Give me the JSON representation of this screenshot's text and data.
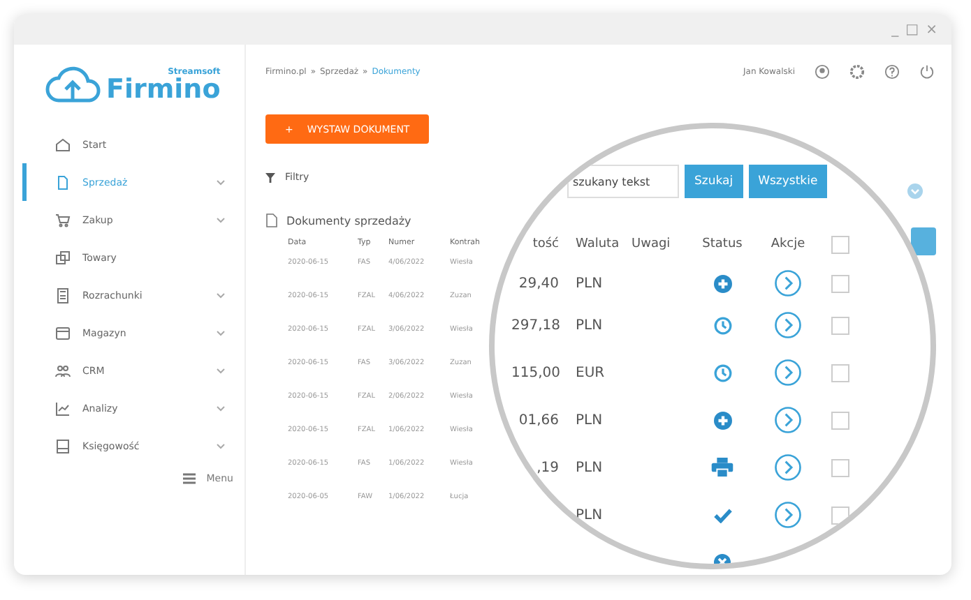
{
  "window": {
    "controls": [
      "_",
      "□",
      "×"
    ]
  },
  "logo": {
    "brand": "Streamsoft",
    "product": "Firmino"
  },
  "sidebar": {
    "items": [
      {
        "label": "Start",
        "kind": "home",
        "expandable": false,
        "selected": false
      },
      {
        "label": "Sprzedaż",
        "kind": "sales",
        "expandable": true,
        "selected": true
      },
      {
        "label": "Zakup",
        "kind": "purchase",
        "expandable": true,
        "selected": false
      },
      {
        "label": "Towary",
        "kind": "goods",
        "expandable": false,
        "selected": false
      },
      {
        "label": "Rozrachunki",
        "kind": "settlements",
        "expandable": true,
        "selected": false
      },
      {
        "label": "Magazyn",
        "kind": "warehouse",
        "expandable": true,
        "selected": false
      },
      {
        "label": "CRM",
        "kind": "crm",
        "expandable": true,
        "selected": false
      },
      {
        "label": "Analizy",
        "kind": "analytics",
        "expandable": true,
        "selected": false
      },
      {
        "label": "Księgowość",
        "kind": "accounting",
        "expandable": true,
        "selected": false
      }
    ],
    "menu_button": "Menu"
  },
  "breadcrumb": [
    "Firmino.pl",
    "»",
    "Sprzedaż",
    "»",
    "Dokumenty"
  ],
  "user": {
    "name": "Jan Kowalski"
  },
  "issue_button": {
    "icon": "+",
    "label": "WYSTAW DOKUMENT"
  },
  "filters": "Filtry",
  "section_title": "Dokumenty sprzedaży",
  "table": {
    "columns": [
      "Data",
      "Typ",
      "Numer",
      "Kontrah"
    ],
    "rows": [
      [
        "2020-06-15",
        "FAS",
        "4/06/2022",
        "Wiesła"
      ],
      [
        "2020-06-15",
        "FZAL",
        "4/06/2022",
        "Zuzan"
      ],
      [
        "2020-06-15",
        "FZAL",
        "3/06/2022",
        "Wiesła"
      ],
      [
        "2020-06-15",
        "FAS",
        "3/06/2022",
        "Zuzan"
      ],
      [
        "2020-06-15",
        "FZAL",
        "2/06/2022",
        "Wiesła"
      ],
      [
        "2020-06-15",
        "FZAL",
        "1/06/2022",
        "Wiesła"
      ],
      [
        "2020-06-15",
        "FAS",
        "1/06/2022",
        "Wiesła"
      ],
      [
        "2020-06-05",
        "FAW",
        "1/06/2022",
        "Łucja"
      ]
    ]
  },
  "magnifier": {
    "search": {
      "placeholder": "szukany tekst"
    },
    "buttons": [
      "Szukaj",
      "Wszystkie"
    ],
    "select_all_checked": false,
    "columns": [
      "tość",
      "Waluta",
      "Uwagi",
      "Status",
      "Akcje"
    ],
    "rows": [
      {
        "amount": "29,40",
        "currency": "PLN",
        "kind": "new",
        "checked": false
      },
      {
        "amount": "297,18",
        "currency": "PLN",
        "kind": "pending",
        "checked": false
      },
      {
        "amount": "115,00",
        "currency": "EUR",
        "kind": "pending",
        "checked": false
      },
      {
        "amount": "01,66",
        "currency": "PLN",
        "kind": "new",
        "checked": false
      },
      {
        "amount": ",19",
        "currency": "PLN",
        "kind": "printed",
        "checked": false
      },
      {
        "currency": "PLN",
        "kind": "done",
        "checked": false
      },
      {
        "kind": "cancelled"
      }
    ]
  }
}
